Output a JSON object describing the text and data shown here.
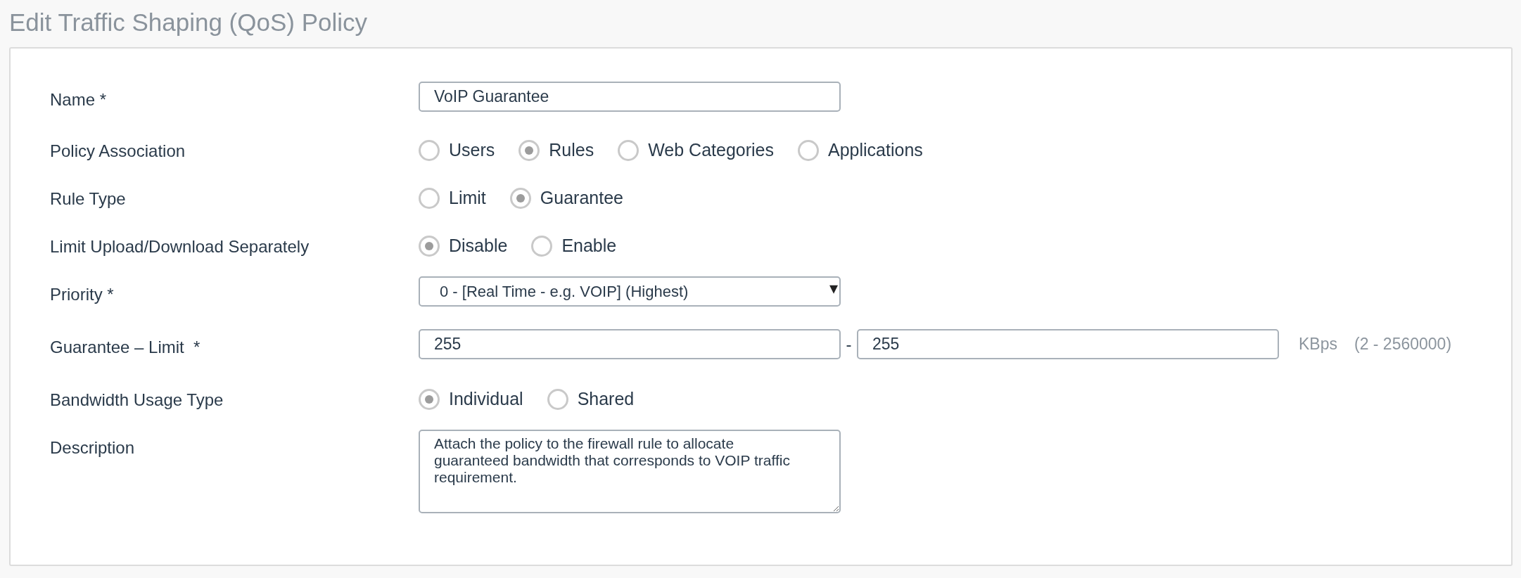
{
  "page_title": "Edit Traffic Shaping (QoS) Policy",
  "fields": [
    {
      "kind": "text",
      "label": "Name *",
      "value": "VoIP Guarantee"
    },
    {
      "kind": "radio",
      "label": "Policy Association",
      "options": [
        {
          "label": "Users",
          "selected": false
        },
        {
          "label": "Rules",
          "selected": true
        },
        {
          "label": "Web Categories",
          "selected": false
        },
        {
          "label": "Applications",
          "selected": false
        }
      ]
    },
    {
      "kind": "radio",
      "label": "Rule Type",
      "options": [
        {
          "label": "Limit",
          "selected": false
        },
        {
          "label": "Guarantee",
          "selected": true
        }
      ]
    },
    {
      "kind": "radio",
      "label": "Limit Upload/Download Separately",
      "options": [
        {
          "label": "Disable",
          "selected": true
        },
        {
          "label": "Enable",
          "selected": false
        }
      ]
    },
    {
      "kind": "select",
      "label": "Priority *",
      "value": "0 - [Real Time - e.g. VOIP] (Highest)",
      "arrow": "▾"
    },
    {
      "kind": "range",
      "label": "Guarantee – Limit  *",
      "from": "255",
      "separator": "-",
      "to": "255",
      "unit": "KBps",
      "hint": "(2 - 2560000)"
    },
    {
      "kind": "radio",
      "label": "Bandwidth Usage Type",
      "options": [
        {
          "label": "Individual",
          "selected": true
        },
        {
          "label": "Shared",
          "selected": false
        }
      ]
    },
    {
      "kind": "textarea",
      "label": "Description",
      "value": "Attach the policy to the firewall rule to allocate guaranteed bandwidth that corresponds to VOIP traffic requirement."
    }
  ]
}
